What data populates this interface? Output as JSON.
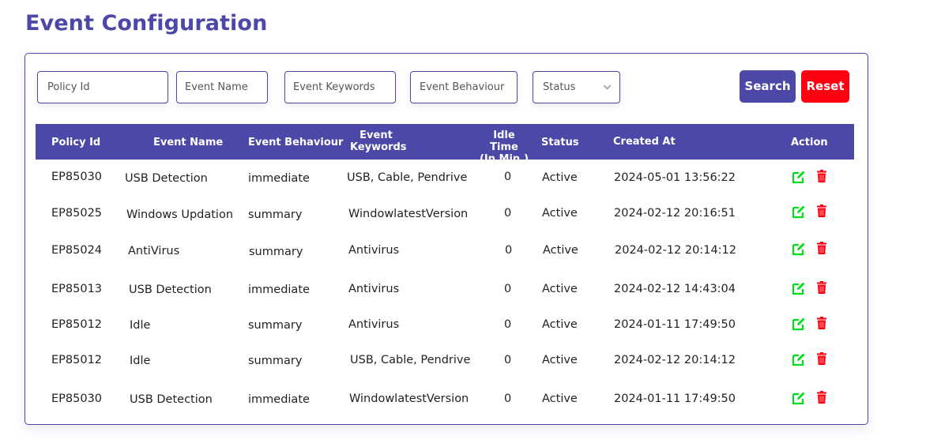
{
  "page": {
    "title": "Event Configuration"
  },
  "filters": {
    "policy_id": {
      "placeholder": "Policy Id",
      "value": ""
    },
    "event_name": {
      "placeholder": "Event Name",
      "value": ""
    },
    "event_keywords": {
      "placeholder": "Event Keywords",
      "value": ""
    },
    "event_behaviour": {
      "placeholder": "Event Behaviour",
      "value": ""
    },
    "status": {
      "selected": "Status",
      "icon": "chevron-down-icon"
    }
  },
  "buttons": {
    "search": "Search",
    "reset": "Reset"
  },
  "colors": {
    "primary": "#4b48a8",
    "danger": "#ff0010",
    "edit_icon": "#00e01a",
    "delete_icon": "#ff0010"
  },
  "table": {
    "headers": {
      "policy_id": "Policy Id",
      "event_name": "Event Name",
      "event_behaviour": "Event Behaviour",
      "event_keywords_1": "Event",
      "event_keywords_2": "Keywords",
      "idle_time_1": "Idle Time",
      "idle_time_2": "(In Min.)",
      "status": "Status",
      "created_at": "Created At",
      "action": "Action"
    },
    "rows": [
      {
        "policy_id": "EP85030",
        "event_name": "USB Detection",
        "event_behaviour": "immediate",
        "event_keywords": "USB, Cable, Pendrive",
        "idle_time": "0",
        "status": "Active",
        "created_at": "2024-05-01 13:56:22"
      },
      {
        "policy_id": "EP85025",
        "event_name": "Windows Updation",
        "event_behaviour": "summary",
        "event_keywords": "WindowlatestVersion",
        "idle_time": "0",
        "status": "Active",
        "created_at": "2024-02-12 20:16:51"
      },
      {
        "policy_id": "EP85024",
        "event_name": "AntiVirus",
        "event_behaviour": "summary",
        "event_keywords": "Antivirus",
        "idle_time": "0",
        "status": "Active",
        "created_at": "2024-02-12 20:14:12"
      },
      {
        "policy_id": "EP85013",
        "event_name": "USB Detection",
        "event_behaviour": "immediate",
        "event_keywords": "Antivirus",
        "idle_time": "0",
        "status": "Active",
        "created_at": "2024-02-12 14:43:04"
      },
      {
        "policy_id": "EP85012",
        "event_name": "Idle",
        "event_behaviour": "summary",
        "event_keywords": "Antivirus",
        "idle_time": "0",
        "status": "Active",
        "created_at": "2024-01-11 17:49:50"
      },
      {
        "policy_id": "EP85012",
        "event_name": "Idle",
        "event_behaviour": "summary",
        "event_keywords": "USB, Cable, Pendrive",
        "idle_time": "0",
        "status": "Active",
        "created_at": "2024-02-12 20:14:12"
      },
      {
        "policy_id": "EP85030",
        "event_name": "USB Detection",
        "event_behaviour": "immediate",
        "event_keywords": "WindowlatestVersion",
        "idle_time": "0",
        "status": "Active",
        "created_at": "2024-01-11 17:49:50"
      }
    ],
    "row_actions": [
      "edit-icon",
      "trash-icon"
    ]
  }
}
